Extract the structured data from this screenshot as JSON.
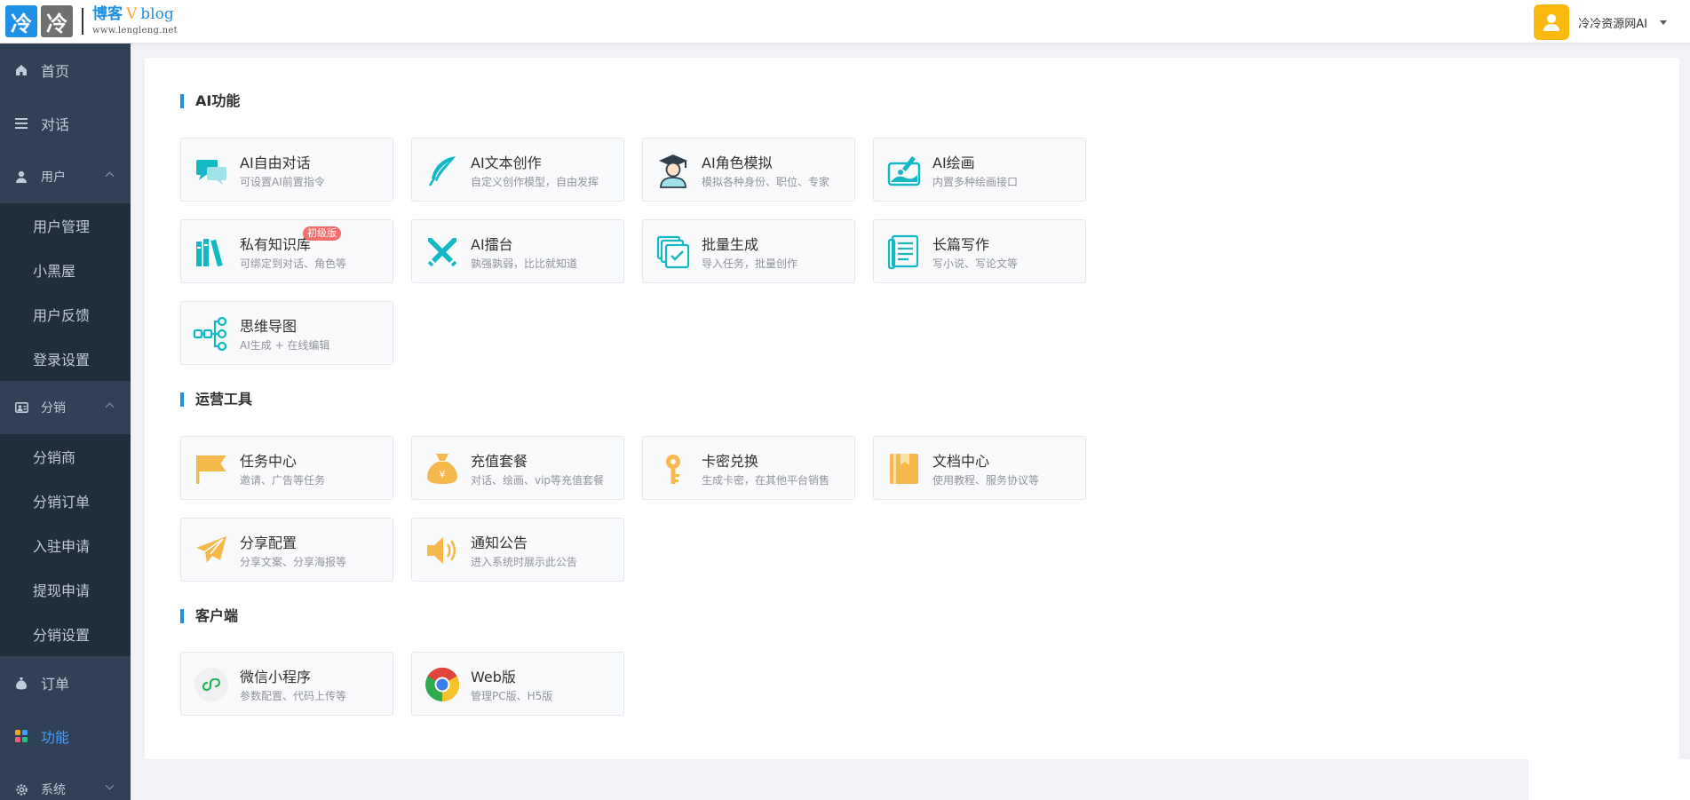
{
  "header": {
    "logo_char_1": "冷",
    "logo_char_2": "冷",
    "logo_title_1": "博客",
    "logo_title_v": "V",
    "logo_title_2": "blog",
    "logo_sub": "www.lengleng.net",
    "user_name": "冷冷资源网AI"
  },
  "sidebar": {
    "home": "首页",
    "chat": "对话",
    "user_group": "用户",
    "user_items": [
      "用户管理",
      "小黑屋",
      "用户反馈",
      "登录设置"
    ],
    "dist_group": "分销",
    "dist_items": [
      "分销商",
      "分销订单",
      "入驻申请",
      "提现申请",
      "分销设置"
    ],
    "order": "订单",
    "feature": "功能",
    "system": "系统"
  },
  "sections": {
    "ai": "AI功能",
    "ops": "运营工具",
    "client": "客户端"
  },
  "cards": {
    "ai_chat": {
      "title": "AI自由对话",
      "desc": "可设置AI前置指令"
    },
    "ai_text": {
      "title": "AI文本创作",
      "desc": "自定义创作模型，自由发挥"
    },
    "ai_role": {
      "title": "AI角色模拟",
      "desc": "模拟各种身份、职位、专家"
    },
    "ai_draw": {
      "title": "AI绘画",
      "desc": "内置多种绘画接口"
    },
    "kb": {
      "title": "私有知识库",
      "desc": "可绑定到对话、角色等",
      "badge": "初级版"
    },
    "arena": {
      "title": "AI擂台",
      "desc": "孰强孰弱，比比就知道"
    },
    "batch": {
      "title": "批量生成",
      "desc": "导入任务，批量创作"
    },
    "long": {
      "title": "长篇写作",
      "desc": "写小说、写论文等"
    },
    "mind": {
      "title": "思维导图",
      "desc": "AI生成 + 在线编辑"
    },
    "task": {
      "title": "任务中心",
      "desc": "邀请、广告等任务"
    },
    "recharge": {
      "title": "充值套餐",
      "desc": "对话、绘画、vip等充值套餐"
    },
    "card_key": {
      "title": "卡密兑换",
      "desc": "生成卡密，在其他平台销售"
    },
    "docs": {
      "title": "文档中心",
      "desc": "使用教程、服务协议等"
    },
    "share": {
      "title": "分享配置",
      "desc": "分享文案、分享海报等"
    },
    "notice": {
      "title": "通知公告",
      "desc": "进入系统时展示此公告"
    },
    "wechat": {
      "title": "微信小程序",
      "desc": "参数配置、代码上传等"
    },
    "web": {
      "title": "Web版",
      "desc": "管理PC版、H5版"
    }
  },
  "colors": {
    "accent": "#1e90e6",
    "sidebar_bg": "#304156",
    "submenu_bg": "#1f2d3d",
    "teal": "#14b8c4",
    "orange": "#f5b84a",
    "badge": "#f56c6c"
  }
}
